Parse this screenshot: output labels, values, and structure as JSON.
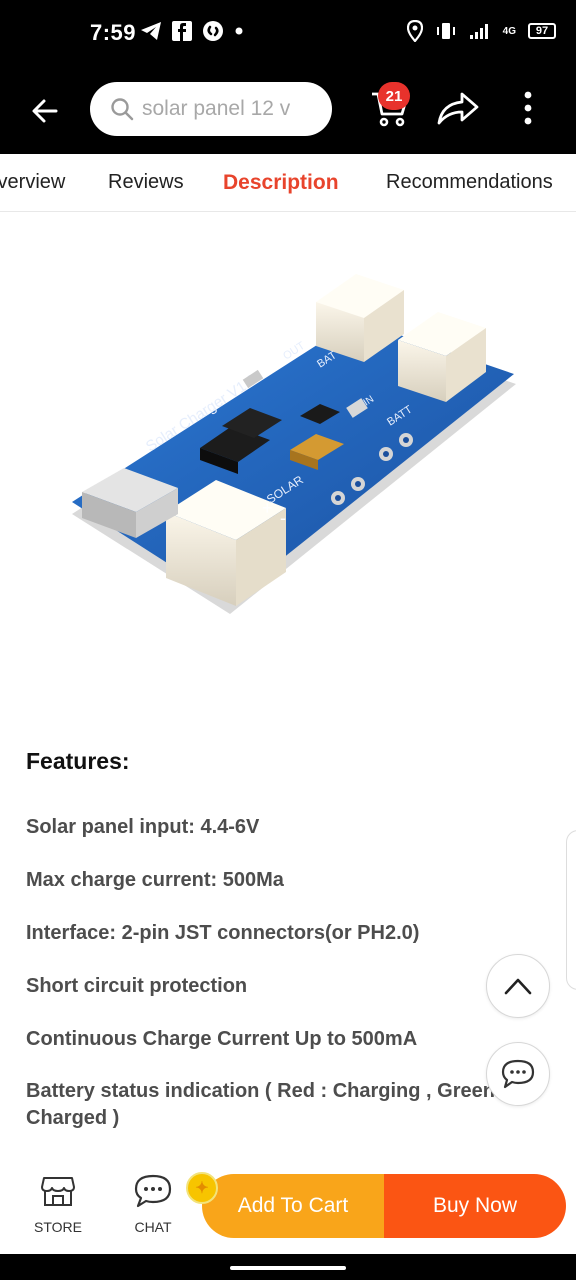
{
  "status_bar": {
    "time": "7:59",
    "battery": "97",
    "network": "4G"
  },
  "search": {
    "placeholder": "solar panel 12 v"
  },
  "cart": {
    "badge": "21"
  },
  "tabs": [
    {
      "label": "Overview"
    },
    {
      "label": "Reviews"
    },
    {
      "label": "Description"
    },
    {
      "label": "Recommendations"
    }
  ],
  "product_image": {
    "board_label": "Solar Charger V1.0",
    "labels": {
      "out": "OUT",
      "bat": "BAT",
      "batt": "BATT",
      "solar": "SOLAR",
      "in": "IN",
      "plus": "+",
      "minus": "-"
    }
  },
  "features": {
    "title": "Features:",
    "items": [
      "Solar panel input: 4.4-6V",
      "Max charge current: 500Ma",
      "Interface: 2-pin JST connectors(or PH2.0)",
      "Short circuit protection",
      "Continuous Charge Current Up to 500mA",
      "Battery status indication ( Red : Charging , Green :",
      "Charged )"
    ]
  },
  "bottom_bar": {
    "store_label": "STORE",
    "chat_label": "CHAT",
    "add_to_cart_label": "Add To Cart",
    "buy_now_label": "Buy Now"
  },
  "colors": {
    "accent": "#e8442c",
    "add_to_cart": "#f9a51a",
    "buy_now": "#fb5513",
    "badge": "#e8322c",
    "pcb": "#1f5fb5"
  },
  "icons": {
    "back": "arrow-left-icon",
    "search": "search-icon",
    "cart": "cart-icon",
    "share": "share-icon",
    "more": "more-vertical-icon",
    "scroll_top": "chevron-up-icon",
    "chat_float": "chat-bubble-icon",
    "store": "store-icon",
    "chat": "chat-icon"
  }
}
